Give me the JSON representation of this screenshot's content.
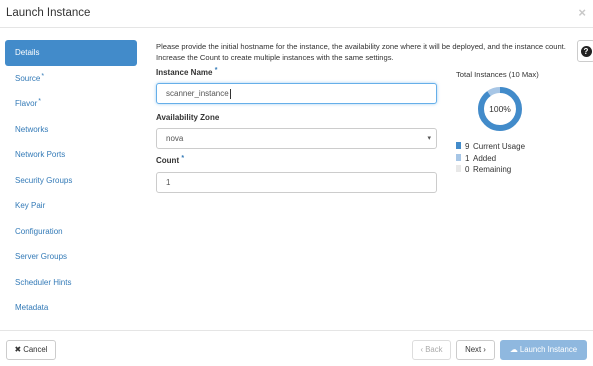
{
  "dialog": {
    "title": "Launch Instance",
    "close_symbol": "×"
  },
  "sidebar": {
    "items": [
      {
        "label": "Details",
        "required": false,
        "active": true
      },
      {
        "label": "Source",
        "required": true,
        "active": false
      },
      {
        "label": "Flavor",
        "required": true,
        "active": false
      },
      {
        "label": "Networks",
        "required": false,
        "active": false
      },
      {
        "label": "Network Ports",
        "required": false,
        "active": false
      },
      {
        "label": "Security Groups",
        "required": false,
        "active": false
      },
      {
        "label": "Key Pair",
        "required": false,
        "active": false
      },
      {
        "label": "Configuration",
        "required": false,
        "active": false
      },
      {
        "label": "Server Groups",
        "required": false,
        "active": false
      },
      {
        "label": "Scheduler Hints",
        "required": false,
        "active": false
      },
      {
        "label": "Metadata",
        "required": false,
        "active": false
      }
    ],
    "required_marker": "*"
  },
  "help": {
    "symbol": "?"
  },
  "form": {
    "intro": "Please provide the initial hostname for the instance, the availability zone where it will be deployed, and the instance count. Increase the Count to create multiple instances with the same settings.",
    "instance_name": {
      "label": "Instance Name",
      "value": "scanner_instance"
    },
    "availability_zone": {
      "label": "Availability Zone",
      "value": "nova",
      "arrow": "▾"
    },
    "count": {
      "label": "Count",
      "value": "1"
    },
    "required_marker": "*"
  },
  "quota": {
    "title": "Total Instances (10 Max)",
    "percent_label": "100%",
    "max": 10,
    "current": 9,
    "added": 1,
    "remaining": 0,
    "legend": [
      {
        "count": "9",
        "label": "Current Usage",
        "color": "#428bca"
      },
      {
        "count": "1",
        "label": "Added",
        "color": "#a7c6e6"
      },
      {
        "count": "0",
        "label": "Remaining",
        "color": "#e8e8e8"
      }
    ]
  },
  "footer": {
    "cancel": "✖ Cancel",
    "back": "‹ Back",
    "next": "Next ›",
    "launch": "☁ Launch Instance"
  }
}
